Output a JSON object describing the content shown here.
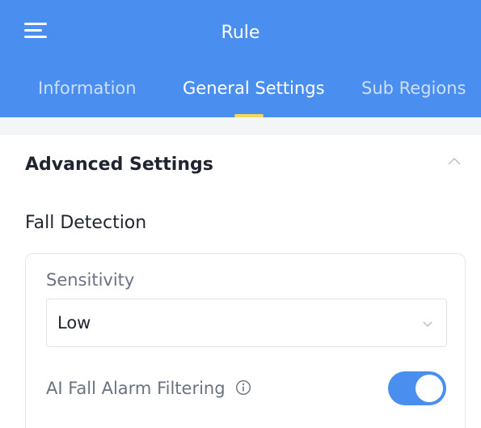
{
  "header": {
    "title": "Rule",
    "background_color": "#4a8ef0",
    "menu_icon": "hamburger-menu-icon",
    "tabs": [
      {
        "label": "Information",
        "active": false
      },
      {
        "label": "General Settings",
        "active": true
      },
      {
        "label": "Sub Regions",
        "active": false
      }
    ],
    "active_indicator_color": "#f5d75a"
  },
  "section": {
    "title": "Advanced Settings",
    "collapse_icon": "chevron-up-icon",
    "expanded": true
  },
  "fall_detection": {
    "title": "Fall Detection",
    "sensitivity": {
      "label": "Sensitivity",
      "value": "Low",
      "icon": "chevron-down-icon"
    },
    "ai_filtering": {
      "label": "AI Fall Alarm Filtering",
      "info_icon": "info-circle-icon",
      "enabled": true,
      "toggle_color": "#4a8ef0"
    }
  }
}
